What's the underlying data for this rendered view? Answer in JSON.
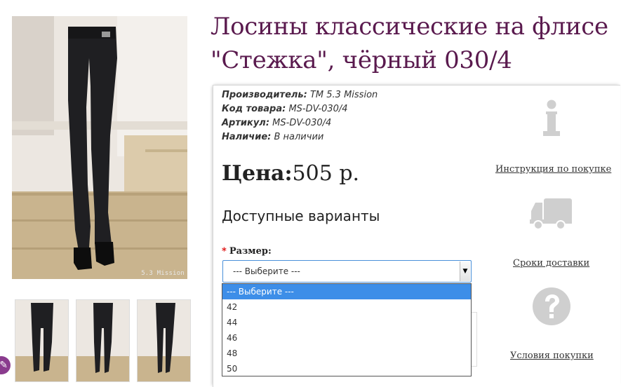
{
  "product": {
    "title": "Лосины классические на флисе \"Стежка\", чёрный 030/4",
    "watermark": "5.3 Mission"
  },
  "specs": [
    {
      "label": "Производитель:",
      "value": "ТМ 5.3 Mission"
    },
    {
      "label": "Код товара:",
      "value": "MS-DV-030/4"
    },
    {
      "label": "Артикул:",
      "value": "MS-DV-030/4"
    },
    {
      "label": "Наличие:",
      "value": "В наличии"
    }
  ],
  "price": {
    "label": "Цена:",
    "value": "505 р."
  },
  "options": {
    "heading": "Доступные варианты",
    "required_mark": "*",
    "size_label": "Размер:",
    "selected": "--- Выберите ---",
    "items": [
      "--- Выберите ---",
      "42",
      "44",
      "46",
      "48",
      "50"
    ]
  },
  "sidebar": {
    "instruction_link": "Инструкция по покупке",
    "delivery_link": "Сроки доставки",
    "terms_link": "Условия покупки"
  },
  "colors": {
    "title": "#5a1a4e",
    "selected_option": "#3d8ee8",
    "icon_gray": "#cfcfcf"
  }
}
